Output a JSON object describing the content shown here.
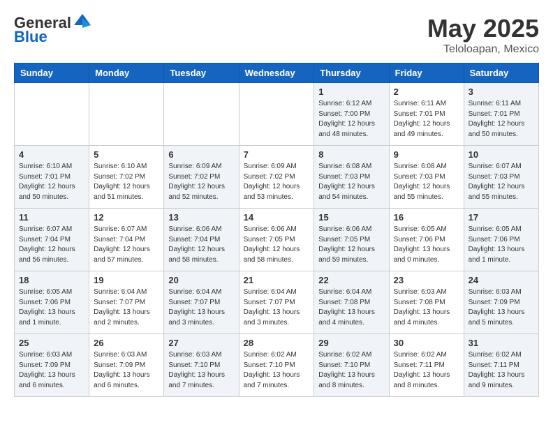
{
  "header": {
    "logo_line1": "General",
    "logo_line2": "Blue",
    "month": "May 2025",
    "location": "Teloloapan, Mexico"
  },
  "days_of_week": [
    "Sunday",
    "Monday",
    "Tuesday",
    "Wednesday",
    "Thursday",
    "Friday",
    "Saturday"
  ],
  "weeks": [
    [
      {
        "day": "",
        "info": ""
      },
      {
        "day": "",
        "info": ""
      },
      {
        "day": "",
        "info": ""
      },
      {
        "day": "",
        "info": ""
      },
      {
        "day": "1",
        "info": "Sunrise: 6:12 AM\nSunset: 7:00 PM\nDaylight: 12 hours\nand 48 minutes."
      },
      {
        "day": "2",
        "info": "Sunrise: 6:11 AM\nSunset: 7:01 PM\nDaylight: 12 hours\nand 49 minutes."
      },
      {
        "day": "3",
        "info": "Sunrise: 6:11 AM\nSunset: 7:01 PM\nDaylight: 12 hours\nand 50 minutes."
      }
    ],
    [
      {
        "day": "4",
        "info": "Sunrise: 6:10 AM\nSunset: 7:01 PM\nDaylight: 12 hours\nand 50 minutes."
      },
      {
        "day": "5",
        "info": "Sunrise: 6:10 AM\nSunset: 7:02 PM\nDaylight: 12 hours\nand 51 minutes."
      },
      {
        "day": "6",
        "info": "Sunrise: 6:09 AM\nSunset: 7:02 PM\nDaylight: 12 hours\nand 52 minutes."
      },
      {
        "day": "7",
        "info": "Sunrise: 6:09 AM\nSunset: 7:02 PM\nDaylight: 12 hours\nand 53 minutes."
      },
      {
        "day": "8",
        "info": "Sunrise: 6:08 AM\nSunset: 7:03 PM\nDaylight: 12 hours\nand 54 minutes."
      },
      {
        "day": "9",
        "info": "Sunrise: 6:08 AM\nSunset: 7:03 PM\nDaylight: 12 hours\nand 55 minutes."
      },
      {
        "day": "10",
        "info": "Sunrise: 6:07 AM\nSunset: 7:03 PM\nDaylight: 12 hours\nand 55 minutes."
      }
    ],
    [
      {
        "day": "11",
        "info": "Sunrise: 6:07 AM\nSunset: 7:04 PM\nDaylight: 12 hours\nand 56 minutes."
      },
      {
        "day": "12",
        "info": "Sunrise: 6:07 AM\nSunset: 7:04 PM\nDaylight: 12 hours\nand 57 minutes."
      },
      {
        "day": "13",
        "info": "Sunrise: 6:06 AM\nSunset: 7:04 PM\nDaylight: 12 hours\nand 58 minutes."
      },
      {
        "day": "14",
        "info": "Sunrise: 6:06 AM\nSunset: 7:05 PM\nDaylight: 12 hours\nand 58 minutes."
      },
      {
        "day": "15",
        "info": "Sunrise: 6:06 AM\nSunset: 7:05 PM\nDaylight: 12 hours\nand 59 minutes."
      },
      {
        "day": "16",
        "info": "Sunrise: 6:05 AM\nSunset: 7:06 PM\nDaylight: 13 hours\nand 0 minutes."
      },
      {
        "day": "17",
        "info": "Sunrise: 6:05 AM\nSunset: 7:06 PM\nDaylight: 13 hours\nand 1 minute."
      }
    ],
    [
      {
        "day": "18",
        "info": "Sunrise: 6:05 AM\nSunset: 7:06 PM\nDaylight: 13 hours\nand 1 minute."
      },
      {
        "day": "19",
        "info": "Sunrise: 6:04 AM\nSunset: 7:07 PM\nDaylight: 13 hours\nand 2 minutes."
      },
      {
        "day": "20",
        "info": "Sunrise: 6:04 AM\nSunset: 7:07 PM\nDaylight: 13 hours\nand 3 minutes."
      },
      {
        "day": "21",
        "info": "Sunrise: 6:04 AM\nSunset: 7:07 PM\nDaylight: 13 hours\nand 3 minutes."
      },
      {
        "day": "22",
        "info": "Sunrise: 6:04 AM\nSunset: 7:08 PM\nDaylight: 13 hours\nand 4 minutes."
      },
      {
        "day": "23",
        "info": "Sunrise: 6:03 AM\nSunset: 7:08 PM\nDaylight: 13 hours\nand 4 minutes."
      },
      {
        "day": "24",
        "info": "Sunrise: 6:03 AM\nSunset: 7:09 PM\nDaylight: 13 hours\nand 5 minutes."
      }
    ],
    [
      {
        "day": "25",
        "info": "Sunrise: 6:03 AM\nSunset: 7:09 PM\nDaylight: 13 hours\nand 6 minutes."
      },
      {
        "day": "26",
        "info": "Sunrise: 6:03 AM\nSunset: 7:09 PM\nDaylight: 13 hours\nand 6 minutes."
      },
      {
        "day": "27",
        "info": "Sunrise: 6:03 AM\nSunset: 7:10 PM\nDaylight: 13 hours\nand 7 minutes."
      },
      {
        "day": "28",
        "info": "Sunrise: 6:02 AM\nSunset: 7:10 PM\nDaylight: 13 hours\nand 7 minutes."
      },
      {
        "day": "29",
        "info": "Sunrise: 6:02 AM\nSunset: 7:10 PM\nDaylight: 13 hours\nand 8 minutes."
      },
      {
        "day": "30",
        "info": "Sunrise: 6:02 AM\nSunset: 7:11 PM\nDaylight: 13 hours\nand 8 minutes."
      },
      {
        "day": "31",
        "info": "Sunrise: 6:02 AM\nSunset: 7:11 PM\nDaylight: 13 hours\nand 9 minutes."
      }
    ]
  ]
}
